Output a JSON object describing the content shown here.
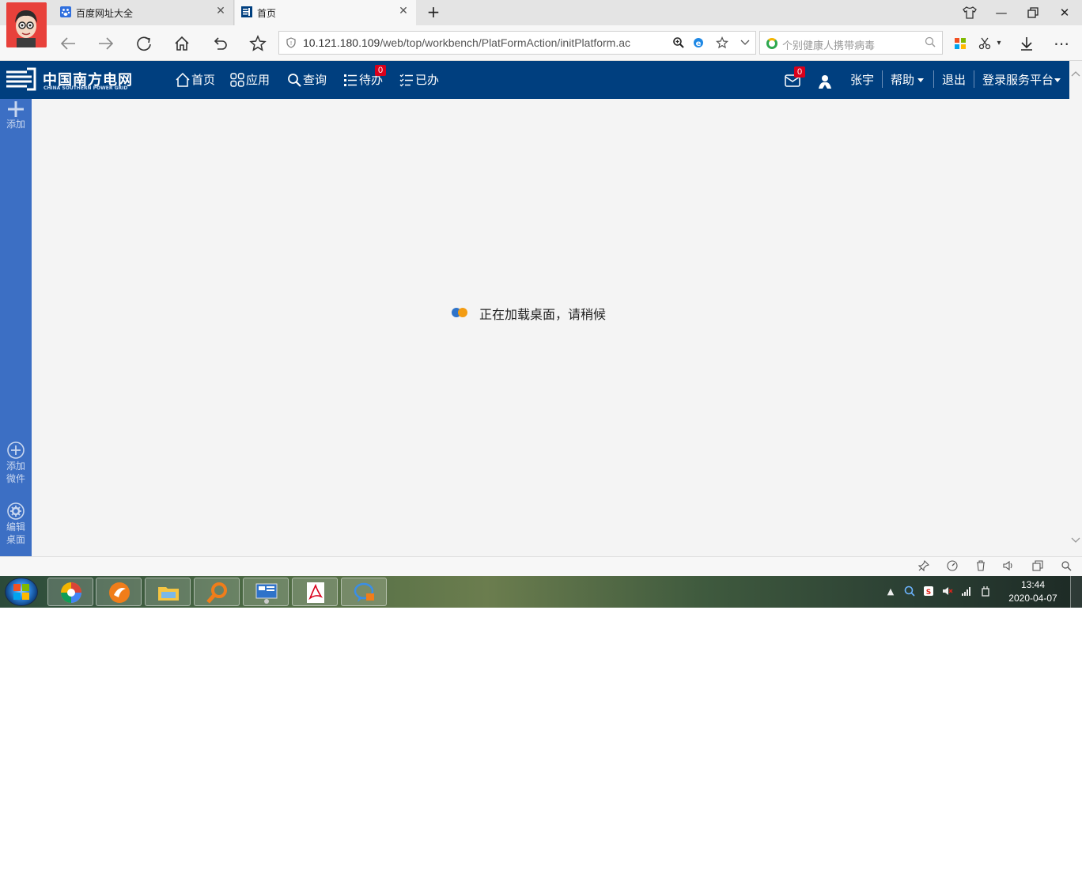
{
  "browser": {
    "tabs": [
      {
        "label": "百度网址大全",
        "active": false
      },
      {
        "label": "首页",
        "active": true
      }
    ],
    "new_tab": "+",
    "url": {
      "host": "10.121.180.109",
      "path": "/web/top/workbench/PlatFormAction/initPlatform.ac"
    },
    "search_placeholder": "个别健康人携带病毒"
  },
  "app": {
    "brand": {
      "name": "中国南方电网",
      "name_en": "CHINA SOUTHERN POWER GRID"
    },
    "menu": [
      {
        "label": "首页",
        "icon": "home-icon"
      },
      {
        "label": "应用",
        "icon": "apps-grid-icon"
      },
      {
        "label": "查询",
        "icon": "search-icon"
      },
      {
        "label": "待办",
        "icon": "todo-list-icon",
        "badge": "0"
      },
      {
        "label": "已办",
        "icon": "done-list-icon"
      }
    ],
    "mail_badge": "0",
    "user_name": "张宇",
    "help_label": "帮助",
    "logout_label": "退出",
    "platform_label": "登录服务平台"
  },
  "sidebar": {
    "add_label": "添加",
    "add_widget_label": "添加微件",
    "add_widget_line1": "添加",
    "add_widget_line2": "微件",
    "edit_desktop_line1": "编辑",
    "edit_desktop_line2": "桌面"
  },
  "main": {
    "loading_text": "正在加载桌面，请稍候"
  },
  "taskbar": {
    "time": "13:44",
    "date": "2020-04-07"
  },
  "colors": {
    "header_bg": "#003f7f",
    "rail_bg": "#3c6fc4",
    "content_bg": "#f4f4f4",
    "badge": "#d9001b",
    "loader_blue": "#2f73c9",
    "loader_orange": "#f39c12"
  }
}
